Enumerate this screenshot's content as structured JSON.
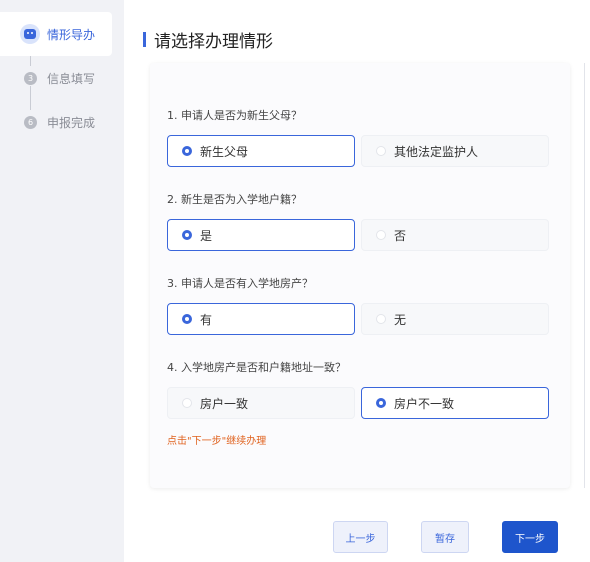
{
  "sidebar": {
    "steps": [
      {
        "label": "情形导办",
        "number": "",
        "active": true
      },
      {
        "label": "信息填写",
        "number": "3",
        "active": false
      },
      {
        "label": "申报完成",
        "number": "6",
        "active": false
      }
    ]
  },
  "main": {
    "title": "请选择办理情形",
    "questions": [
      {
        "text": "1. 申请人是否为新生父母？",
        "options": [
          "新生父母",
          "其他法定监护人"
        ],
        "selected": 0
      },
      {
        "text": "2. 新生是否为入学地户籍？",
        "options": [
          "是",
          "否"
        ],
        "selected": 0
      },
      {
        "text": "3. 申请人是否有入学地房产？",
        "options": [
          "有",
          "无"
        ],
        "selected": 0
      },
      {
        "text": "4. 入学地房产是否和户籍地址一致？",
        "options": [
          "房户一致",
          "房户不一致"
        ],
        "selected": 1
      }
    ],
    "hint": "点击\"下一步\"继续办理"
  },
  "footer": {
    "prev_label": "上一步",
    "save_label": "暂存",
    "next_label": "下一步"
  },
  "colors": {
    "accent": "#3a66db",
    "primary_button": "#1e55cc",
    "hint": "#e0621e",
    "sidebar_bg": "#f1f2f6"
  }
}
